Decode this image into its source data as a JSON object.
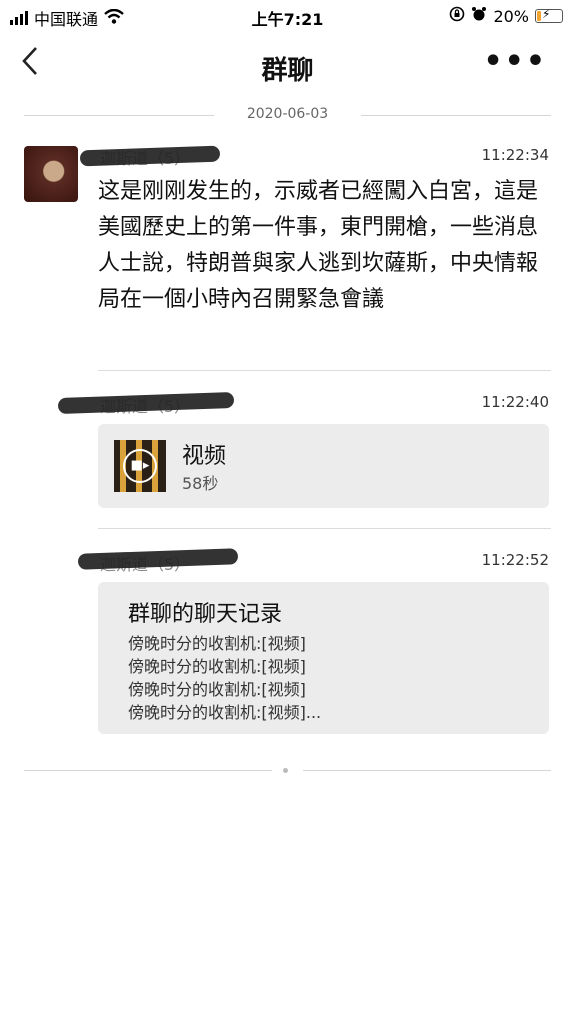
{
  "status": {
    "carrier": "中国联通",
    "time": "上午7:21",
    "battery": "20%",
    "battery_level": 0.2
  },
  "nav": {
    "back": "<",
    "title": "群聊",
    "more": "•••"
  },
  "date_divider": "2020-06-03",
  "messages": [
    {
      "sender": "迦斯道（5）",
      "time": "11:22:34",
      "text": "这是刚刚发生的，示威者已經闖入白宮，這是美國歷史上的第一件事，東門開槍，一些消息人士說，特朗普與家人逃到坎薩斯，中央情報局在一個小時內召開緊急會議"
    },
    {
      "sender": "迦斯道（5）",
      "time": "11:22:40",
      "video": {
        "title": "视频",
        "duration": "58秒"
      }
    },
    {
      "sender": "迦斯道（5）",
      "time": "11:22:52",
      "record": {
        "title": "群聊的聊天记录",
        "lines": [
          "傍晚时分的收割机:[视频]",
          "傍晚时分的收割机:[视频]",
          "傍晚时分的收割机:[视频]",
          "傍晚时分的收割机:[视频]..."
        ]
      }
    }
  ]
}
